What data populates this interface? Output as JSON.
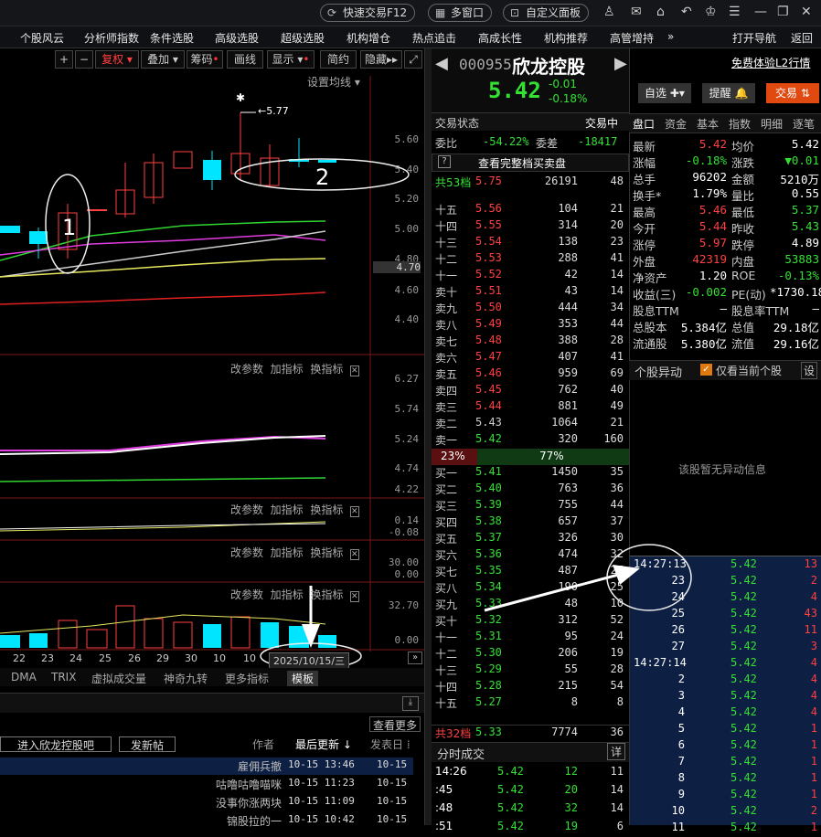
{
  "topbar": {
    "quick_trade": "快速交易F12",
    "multi_window": "多窗口",
    "custom_panel": "自定义面板"
  },
  "menu": [
    "个股风云",
    "分析师指数",
    "条件选股",
    "高级选股",
    "超级选股",
    "机构增仓",
    "热点追击",
    "高成长性",
    "机构推荐",
    "高管增持",
    "»",
    "打开导航",
    "返回"
  ],
  "toolbar": {
    "plus": "+",
    "minus": "−",
    "fuquan": "复权",
    "diejia": "叠加",
    "chouma": "筹码",
    "huaxian": "画线",
    "xianshi": "显示",
    "jianyue": "简约",
    "yincang": "隐藏"
  },
  "chart": {
    "ma_setting": "设置均线",
    "price_axis": [
      "5.60",
      "5.40",
      "5.20",
      "5.00",
      "4.80",
      "4.60",
      "4.40"
    ],
    "price_marker": "4.70",
    "high_label": "5.77",
    "ind2_axis": [
      "6.27",
      "5.74",
      "5.24",
      "4.74",
      "4.22"
    ],
    "ind3_axis": [
      "0.14",
      "-0.08"
    ],
    "ind4_axis": [
      "30.00",
      "0.00"
    ],
    "ind5_axis": [
      "32.70",
      "0.00"
    ],
    "ind_controls": {
      "change": "改参数",
      "add": "加指标",
      "switch": "换指标"
    },
    "dates": [
      "22",
      "23",
      "24",
      "25",
      "26",
      "29",
      "30",
      "10",
      "10"
    ],
    "hover_date": "2025/10/15/三",
    "annotation1": "1",
    "annotation2": "2",
    "bottom_tabs": [
      "DMA",
      "TRIX",
      "虚拟成交量",
      "神奇九转",
      "更多指标",
      "模板"
    ]
  },
  "forum": {
    "enter": "进入欣龙控股吧",
    "post": "发新帖",
    "view_more": "查看更多",
    "author": "作者",
    "last_update": "最后更新",
    "post_date": "发表日",
    "posts": [
      {
        "author": "雇佣兵撤",
        "update": "10-15 13:46",
        "date": "10-15"
      },
      {
        "author": "咕噜咕噜喵咪",
        "update": "10-15 11:23",
        "date": "10-15"
      },
      {
        "author": "没事你涨两块",
        "update": "10-15 11:09",
        "date": "10-15"
      },
      {
        "author": "锦股拉的一",
        "update": "10-15 10:42",
        "date": "10-15"
      }
    ]
  },
  "stock": {
    "code": "000955",
    "name": "欣龙控股",
    "price": "5.42",
    "change": "-0.01",
    "pct": "-0.18%",
    "l2": "免费体验L2行情",
    "zixuan": "自选",
    "tixing": "提醒",
    "jiaoyi": "交易"
  },
  "orderbook": {
    "status_label": "交易状态",
    "status": "交易中",
    "webi_label": "委比",
    "webi": "-54.22%",
    "weicha_label": "委差",
    "weicha": "-18417",
    "full": "查看完整档买卖盘",
    "ask_total": {
      "label": "共53档",
      "price": "5.75",
      "vol": "26191",
      "cnt": "48"
    },
    "asks": [
      [
        "十五",
        "5.56",
        "104",
        "21"
      ],
      [
        "十四",
        "5.55",
        "314",
        "20"
      ],
      [
        "十三",
        "5.54",
        "138",
        "23"
      ],
      [
        "十二",
        "5.53",
        "288",
        "41"
      ],
      [
        "十一",
        "5.52",
        "42",
        "14"
      ],
      [
        "卖十",
        "5.51",
        "43",
        "14"
      ],
      [
        "卖九",
        "5.50",
        "444",
        "34"
      ],
      [
        "卖八",
        "5.49",
        "353",
        "44"
      ],
      [
        "卖七",
        "5.48",
        "388",
        "28"
      ],
      [
        "卖六",
        "5.47",
        "407",
        "41"
      ],
      [
        "卖五",
        "5.46",
        "959",
        "69"
      ],
      [
        "卖四",
        "5.45",
        "762",
        "40"
      ],
      [
        "卖三",
        "5.44",
        "881",
        "49"
      ],
      [
        "卖二",
        "5.43",
        "1064",
        "21"
      ],
      [
        "卖一",
        "5.42",
        "320",
        "160"
      ]
    ],
    "ratio_sell": "23%",
    "ratio_buy": "77%",
    "bids": [
      [
        "买一",
        "5.41",
        "1450",
        "35"
      ],
      [
        "买二",
        "5.40",
        "763",
        "36"
      ],
      [
        "买三",
        "5.39",
        "755",
        "44"
      ],
      [
        "买四",
        "5.38",
        "657",
        "37"
      ],
      [
        "买五",
        "5.37",
        "326",
        "30"
      ],
      [
        "买六",
        "5.36",
        "474",
        "32"
      ],
      [
        "买七",
        "5.35",
        "487",
        "27"
      ],
      [
        "买八",
        "5.34",
        "190",
        "25"
      ],
      [
        "买九",
        "5.33",
        "48",
        "10"
      ],
      [
        "买十",
        "5.32",
        "312",
        "52"
      ],
      [
        "十一",
        "5.31",
        "95",
        "24"
      ],
      [
        "十二",
        "5.30",
        "206",
        "19"
      ],
      [
        "十三",
        "5.29",
        "55",
        "28"
      ],
      [
        "十四",
        "5.28",
        "215",
        "54"
      ],
      [
        "十五",
        "5.27",
        "8",
        "8"
      ]
    ],
    "bid_total": {
      "label": "共32档",
      "price": "5.33",
      "vol": "7774",
      "cnt": "36"
    },
    "fenshi": "分时成交",
    "detail": "详",
    "trades": [
      [
        "14:26",
        "5.42",
        "12",
        "11"
      ],
      [
        ":45",
        "5.42",
        "20",
        "14"
      ],
      [
        ":48",
        "5.42",
        "32",
        "14"
      ],
      [
        ":51",
        "5.42",
        "19",
        "6"
      ]
    ]
  },
  "tabs": [
    "盘口",
    "资金",
    "基本",
    "指数",
    "明细",
    "逐笔"
  ],
  "info": [
    [
      "最新",
      "5.42",
      "均价",
      "5.42"
    ],
    [
      "涨幅",
      "-0.18%",
      "涨跌",
      "▼0.01"
    ],
    [
      "总手",
      "96202",
      "金额",
      "5210万"
    ],
    [
      "换手*",
      "1.79%",
      "量比",
      "0.55"
    ],
    [
      "最高",
      "5.46",
      "最低",
      "5.37"
    ],
    [
      "今开",
      "5.44",
      "昨收",
      "5.43"
    ],
    [
      "涨停",
      "5.97",
      "跌停",
      "4.89"
    ],
    [
      "外盘",
      "42319",
      "内盘",
      "53883"
    ],
    [
      "净资产",
      "1.20",
      "ROE",
      "-0.13%"
    ],
    [
      "收益(三)",
      "-0.002",
      "PE(动)",
      "*1730.18"
    ],
    [
      "股息TTM",
      "—",
      "股息率TTM",
      "—"
    ],
    [
      "总股本",
      "5.384亿",
      "总值",
      "29.18亿"
    ],
    [
      "流通股",
      "5.380亿",
      "流值",
      "29.16亿"
    ]
  ],
  "abnormal": {
    "title": "个股异动",
    "only_current": "仅看当前个股",
    "settings": "设",
    "empty": "该股暂无异动信息"
  },
  "ticks": [
    [
      "14:27:13",
      "5.42",
      "13"
    ],
    [
      "23",
      "5.42",
      "2"
    ],
    [
      "24",
      "5.42",
      "4"
    ],
    [
      "25",
      "5.42",
      "43"
    ],
    [
      "26",
      "5.42",
      "11"
    ],
    [
      "27",
      "5.42",
      "3"
    ],
    [
      "14:27:14",
      "5.42",
      "4"
    ],
    [
      "2",
      "5.42",
      "4"
    ],
    [
      "3",
      "5.42",
      "4"
    ],
    [
      "4",
      "5.42",
      "4"
    ],
    [
      "5",
      "5.42",
      "1"
    ],
    [
      "6",
      "5.42",
      "1"
    ],
    [
      "7",
      "5.42",
      "1"
    ],
    [
      "8",
      "5.42",
      "1"
    ],
    [
      "9",
      "5.42",
      "1"
    ],
    [
      "10",
      "5.42",
      "2"
    ],
    [
      "11",
      "5.42",
      "1"
    ]
  ]
}
